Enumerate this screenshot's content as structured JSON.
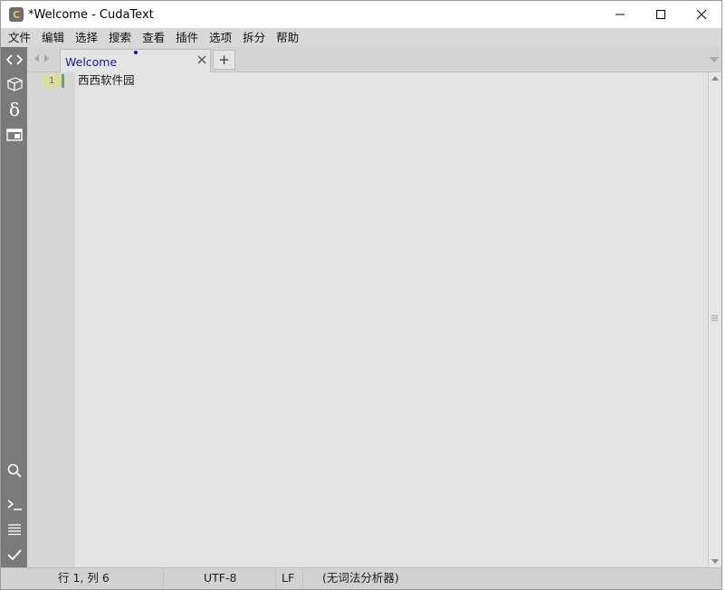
{
  "window": {
    "title": "*Welcome - CudaText",
    "app_icon_letter": "C"
  },
  "menu": [
    "文件",
    "编辑",
    "选择",
    "搜索",
    "查看",
    "插件",
    "选项",
    "拆分",
    "帮助"
  ],
  "tabs": [
    {
      "title": "Welcome",
      "modified": true,
      "active": true
    }
  ],
  "tab_add_label": "+",
  "editor": {
    "lines": [
      {
        "number": "1",
        "text": "西西软件园"
      }
    ]
  },
  "statusbar": {
    "position": "行 1, 列 6",
    "encoding": "UTF-8",
    "line_ending": "LF",
    "lexer": "(无词法分析器)"
  },
  "sidebar_icons": [
    "code-tree-icon",
    "project-icon",
    "delta-icon",
    "tabs-panel-icon",
    "search-panel-icon",
    "console-icon",
    "output-icon",
    "validate-icon"
  ],
  "colors": {
    "sidebar": "#7a7a7a",
    "editor_bg": "#e3e3e3",
    "tab_title": "#1a1a8c",
    "line_number_bg": "#dcdc9c"
  }
}
